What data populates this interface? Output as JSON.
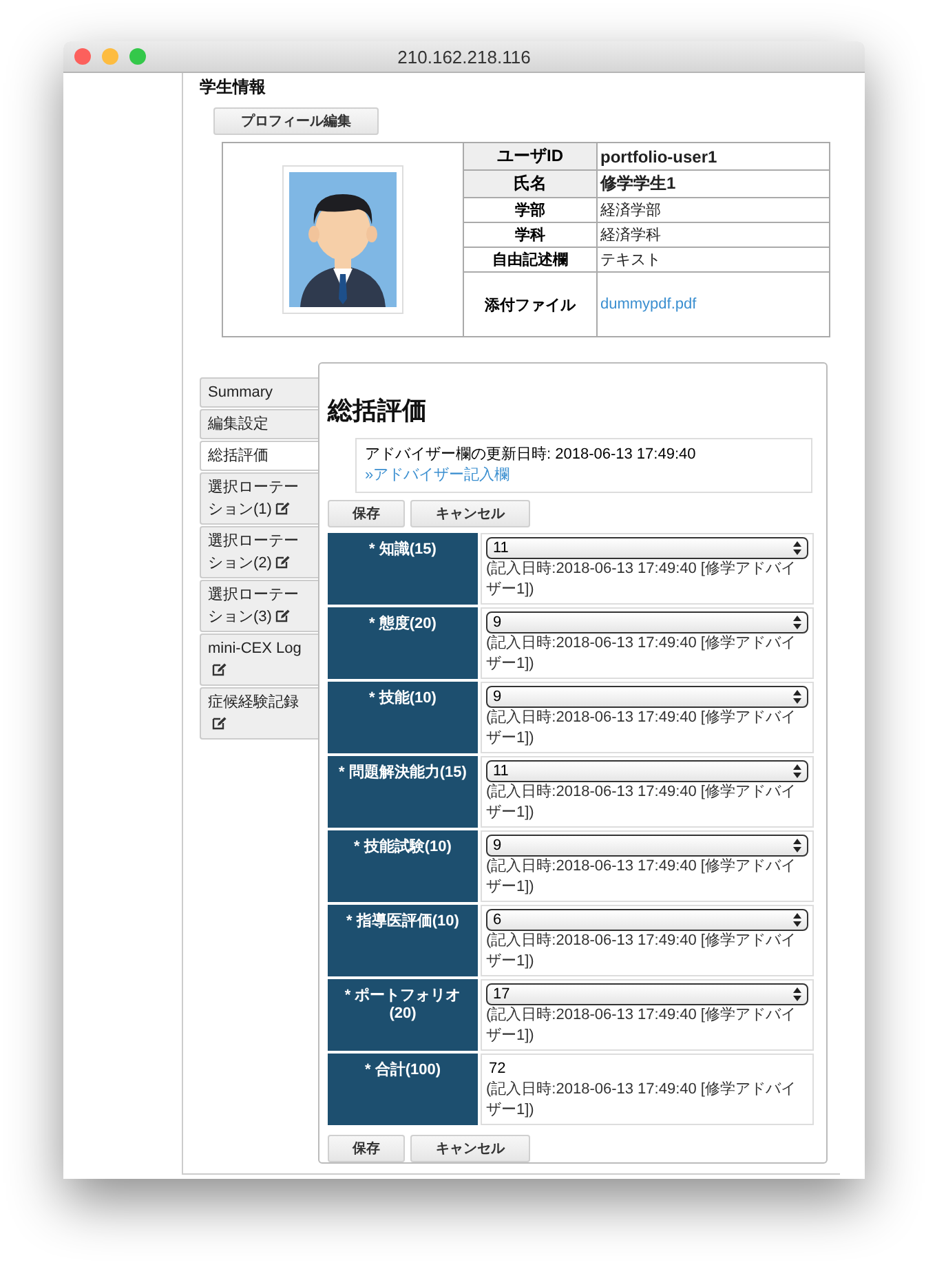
{
  "window": {
    "title": "210.162.218.116"
  },
  "section_title": "学生情報",
  "profile_edit_button": "プロフィール編集",
  "profile": {
    "rows": [
      {
        "label": "ユーザID",
        "value": "portfolio-user1",
        "kind": "bold"
      },
      {
        "label": "氏名",
        "value": "修学学生1",
        "kind": "bold"
      },
      {
        "label": "学部",
        "value": "経済学部",
        "kind": "plain"
      },
      {
        "label": "学科",
        "value": "経済学科",
        "kind": "plain"
      },
      {
        "label": "自由記述欄",
        "value": "テキスト",
        "kind": "plain"
      },
      {
        "label": "添付ファイル",
        "value": "dummypdf.pdf",
        "kind": "link"
      }
    ]
  },
  "side_tabs": [
    {
      "label": "Summary",
      "selected": false,
      "edit_icon": false
    },
    {
      "label": "編集設定",
      "selected": false,
      "edit_icon": false
    },
    {
      "label": "総括評価",
      "selected": true,
      "edit_icon": false
    },
    {
      "label": "選択ローテーション(1)",
      "selected": false,
      "edit_icon": true
    },
    {
      "label": "選択ローテーション(2)",
      "selected": false,
      "edit_icon": true
    },
    {
      "label": "選択ローテーション(3)",
      "selected": false,
      "edit_icon": true
    },
    {
      "label": "mini-CEX Log",
      "selected": false,
      "edit_icon": true
    },
    {
      "label": "症候経験記録",
      "selected": false,
      "edit_icon": true
    }
  ],
  "panel": {
    "title": "総括評価",
    "info": {
      "text": "アドバイザー欄の更新日時: 2018-06-13 17:49:40",
      "link": "»アドバイザー記入欄"
    },
    "buttons": [
      "保存",
      "キャンセル"
    ],
    "rows": [
      {
        "label": "* 知識(15)",
        "kind": "select",
        "value": "11",
        "note": "(記入日時:2018-06-13 17:49:40 [修学アドバイザー1])"
      },
      {
        "label": "* 態度(20)",
        "kind": "select",
        "value": "9",
        "note": "(記入日時:2018-06-13 17:49:40 [修学アドバイザー1])"
      },
      {
        "label": "* 技能(10)",
        "kind": "select",
        "value": "9",
        "note": "(記入日時:2018-06-13 17:49:40 [修学アドバイザー1])"
      },
      {
        "label": "* 問題解決能力(15)",
        "kind": "select",
        "value": "11",
        "note": "(記入日時:2018-06-13 17:49:40 [修学アドバイザー1])"
      },
      {
        "label": "* 技能試験(10)",
        "kind": "select",
        "value": "9",
        "note": "(記入日時:2018-06-13 17:49:40 [修学アドバイザー1])"
      },
      {
        "label": "* 指導医評価(10)",
        "kind": "select",
        "value": "6",
        "note": "(記入日時:2018-06-13 17:49:40 [修学アドバイザー1])"
      },
      {
        "label": "* ポートフォリオ(20)",
        "kind": "select",
        "value": "17",
        "note": "(記入日時:2018-06-13 17:49:40 [修学アドバイザー1])"
      },
      {
        "label": "* 合計(100)",
        "kind": "text",
        "value": "72",
        "note": "(記入日時:2018-06-13 17:49:40 [修学アドバイザー1])"
      }
    ],
    "bottom_buttons": [
      "保存",
      "キャンセル"
    ]
  }
}
